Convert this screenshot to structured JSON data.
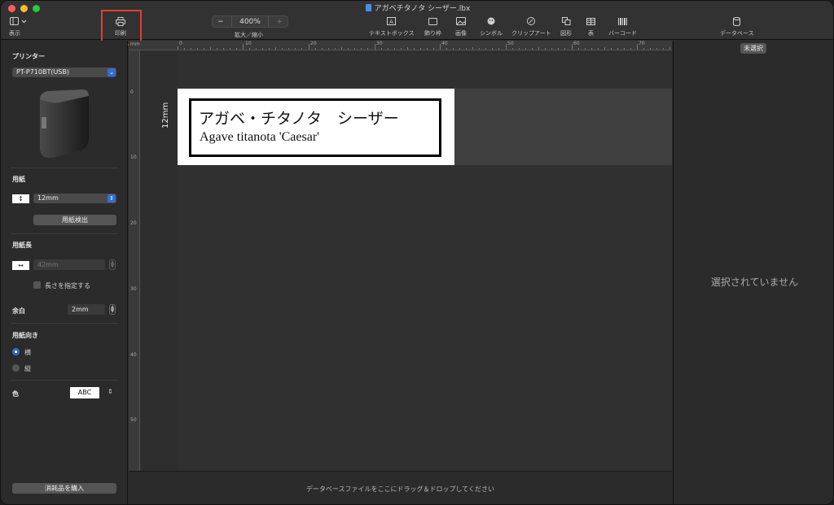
{
  "window": {
    "title": "アガベチタノタ シーザー.lbx",
    "lights": [
      "#ff5f57",
      "#febc2e",
      "#28c840"
    ]
  },
  "toolbar": {
    "view_label": "表示",
    "print_label": "印刷",
    "zoom_value": "400%",
    "zoom_minus": "−",
    "zoom_plus": "+",
    "zoom_label": "拡大／縮小",
    "text_box_label": "テキストボックス",
    "frame_label": "飾り枠",
    "image_label": "画像",
    "symbol_label": "シンボル",
    "clipart_label": "クリップアート",
    "shape_label": "図形",
    "table_label": "表",
    "barcode_label": "バーコード",
    "database_label": "データベース"
  },
  "sidebar": {
    "printer_heading": "プリンター",
    "printer_value": "PT-P710BT(USB)",
    "paper_heading": "用紙",
    "paper_value": "12mm",
    "detect_button": "用紙検出",
    "length_heading": "用紙長",
    "length_value": "42mm",
    "specify_length_label": "長さを指定する",
    "margin_label": "余白",
    "margin_value": "2mm",
    "orientation_heading": "用紙向き",
    "orientation_landscape": "横",
    "orientation_portrait": "縦",
    "color_label": "色",
    "color_value": "ABC",
    "buy_button": "消耗品を購入"
  },
  "canvas": {
    "ruler_unit": "mm",
    "h_ruler_numbers": [
      "0",
      "10",
      "20",
      "30",
      "40",
      "50",
      "60",
      "70"
    ],
    "v_ruler_numbers": [
      "0",
      "10",
      "20",
      "30",
      "40",
      "50"
    ],
    "tape_width_label": "12mm",
    "label_line1": "アガベ・チタノタ　シーザー",
    "label_line2": "Agave titanota 'Caesar'",
    "drop_hint": "データベースファイルをここにドラッグ＆ドロップしてください"
  },
  "right_panel": {
    "badge": "未選択",
    "empty_message": "選択されていません"
  }
}
